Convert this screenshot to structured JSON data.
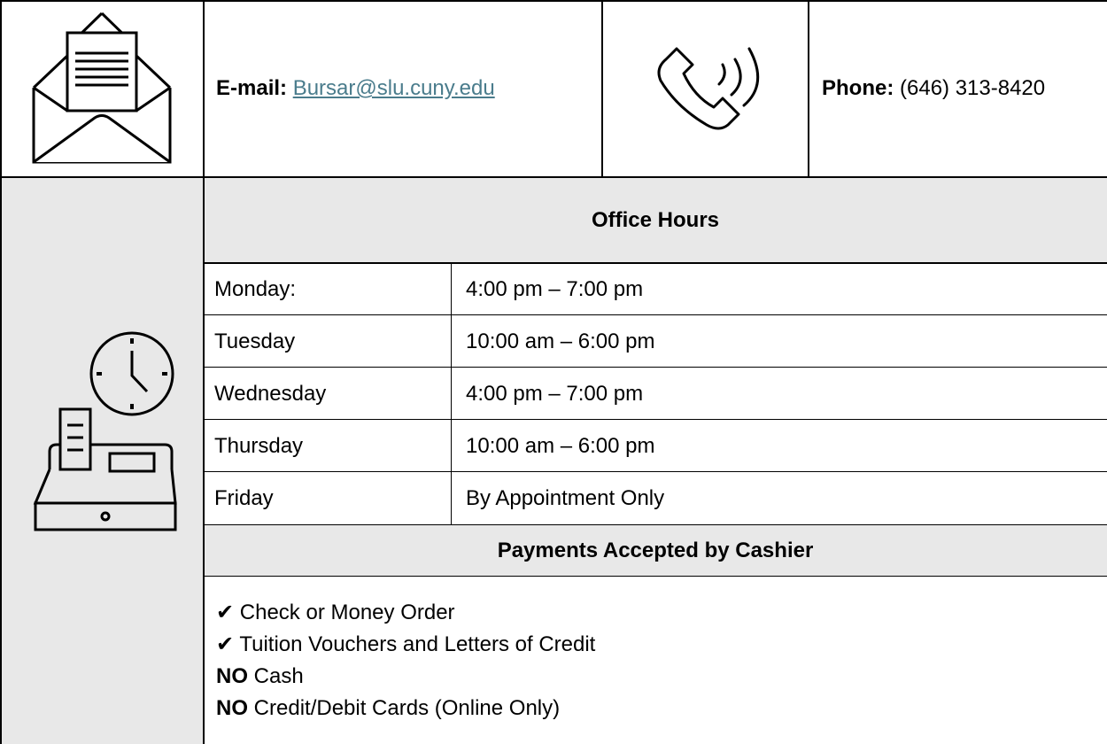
{
  "contact": {
    "email_label": "E-mail:",
    "email_value": "Bursar@slu.cuny.edu",
    "phone_label": "Phone:",
    "phone_value": "(646) 313-8420"
  },
  "icons": {
    "email": "envelope-letter-icon",
    "phone": "phone-ringing-icon",
    "cashier": "clock-cash-register-icon"
  },
  "office_hours": {
    "title": "Office Hours",
    "rows": [
      {
        "day": "Monday:",
        "hours": "4:00 pm – 7:00 pm"
      },
      {
        "day": "Tuesday",
        "hours": "10:00 am – 6:00 pm"
      },
      {
        "day": "Wednesday",
        "hours": "4:00 pm – 7:00 pm"
      },
      {
        "day": "Thursday",
        "hours": "10:00 am – 6:00 pm"
      },
      {
        "day": "Friday",
        "hours": "By Appointment Only"
      }
    ]
  },
  "payments": {
    "title": "Payments Accepted by Cashier",
    "check_mark": "✔",
    "accepted": [
      "Check or Money Order",
      "Tuition Vouchers and Letters of Credit"
    ],
    "no_label": "NO",
    "not_accepted": [
      "Cash",
      "Credit/Debit Cards (Online Only)"
    ]
  },
  "colors": {
    "header_gray": "#e8e8e8",
    "link": "#4a7c8c",
    "border": "#000000"
  }
}
